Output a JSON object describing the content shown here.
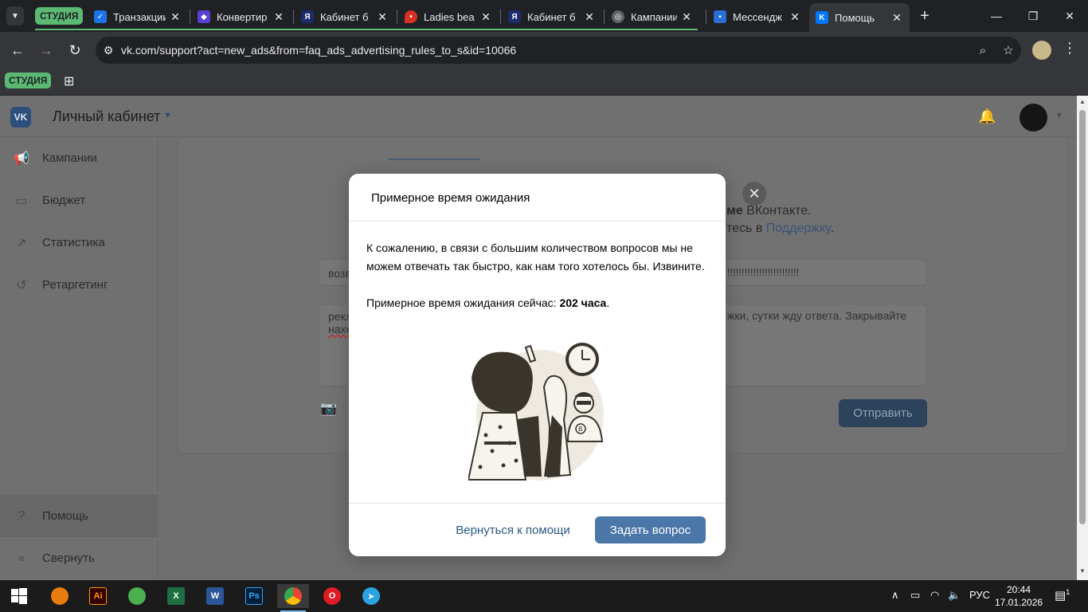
{
  "browser": {
    "tab_group_label": "СТУДИЯ",
    "tabs": [
      {
        "title": "Транзакции",
        "icon": "wallet-icon",
        "color": "#1a73e8"
      },
      {
        "title": "Конвертир",
        "icon": "shield-icon",
        "color": "#5b3fd1"
      },
      {
        "title": "Кабинет б",
        "icon": "yandex-icon",
        "color": "#1d2b6b"
      },
      {
        "title": "Ladies bea",
        "icon": "map-pin-icon",
        "color": "#d93025"
      },
      {
        "title": "Кабинет б",
        "icon": "yandex-icon",
        "color": "#1d2b6b"
      },
      {
        "title": "Кампании",
        "icon": "globe-icon",
        "color": "#5f6368"
      },
      {
        "title": "Мессендж",
        "icon": "chat-icon",
        "color": "#2a6fd6"
      },
      {
        "title": "Помощь",
        "icon": "vk-icon",
        "color": "#0077ff"
      }
    ],
    "url": "vk.com/support?act=new_ads&from=faq_ads_advertising_rules_to_s&id=10066",
    "bookmark_group_label": "СТУДИЯ"
  },
  "vk": {
    "logo_text": "VK",
    "header_title": "Личный кабинет",
    "sidebar": [
      {
        "label": "Кампании",
        "icon": "megaphone-icon"
      },
      {
        "label": "Бюджет",
        "icon": "wallet-icon"
      },
      {
        "label": "Статистика",
        "icon": "chart-icon"
      },
      {
        "label": "Ретаргетинг",
        "icon": "retarget-icon"
      }
    ],
    "sidebar_bottom": [
      {
        "label": "Помощь",
        "icon": "help-icon"
      },
      {
        "label": "Свернуть",
        "icon": "collapse-icon"
      }
    ],
    "background": {
      "line1_bold": "ме",
      "line1_rest": " ВКонтакте.",
      "line2_prefix": "тесь в ",
      "line2_link": "Поддержку",
      "line2_suffix": ".",
      "input_value_left": "возв",
      "input_value_right": "!!!!!!!!!!!!!!!!!!!!!!!!!",
      "textarea_left": "рекл",
      "textarea_left2": "нахе",
      "textarea_right": "жки, сутки жду ответа. Закрывайте",
      "send_label": "Отправить"
    }
  },
  "modal": {
    "title": "Примерное время ожидания",
    "body_p1": "К сожалению, в связи с большим количеством вопросов мы не можем отвечать так быстро, как нам того хотелось бы. Извините.",
    "body_p2_prefix": "Примерное время ожидания сейчас: ",
    "body_p2_value": "202 часа",
    "body_p2_suffix": ".",
    "back_label": "Вернуться к помощи",
    "ask_label": "Задать вопрос"
  },
  "taskbar": {
    "apps": [
      {
        "name": "blender",
        "label": "",
        "color": "#e87d0d"
      },
      {
        "name": "illustrator",
        "label": "Ai",
        "color": "#330000"
      },
      {
        "name": "green-app",
        "label": "",
        "color": "#4caf50"
      },
      {
        "name": "excel",
        "label": "X",
        "color": "#1d6f42"
      },
      {
        "name": "word",
        "label": "W",
        "color": "#2b579a"
      },
      {
        "name": "photoshop",
        "label": "Ps",
        "color": "#001e36"
      },
      {
        "name": "chrome",
        "label": "",
        "color": "#4285f4"
      },
      {
        "name": "opera",
        "label": "O",
        "color": "#e01b22"
      },
      {
        "name": "telegram",
        "label": "",
        "color": "#2aa3e0"
      }
    ],
    "language": "РУС",
    "time": "20:44",
    "date": "17.01.2026",
    "notifications": "1"
  },
  "colors": {
    "accent_button": "#4a76a8",
    "link": "#2a5885",
    "group_green": "#5bb974"
  }
}
